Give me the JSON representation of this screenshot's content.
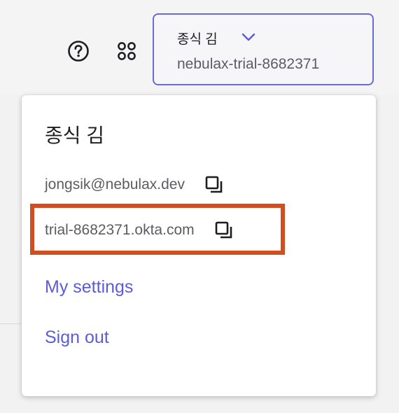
{
  "header": {
    "help_icon": "help-circle-icon",
    "apps_icon": "apps-grid-icon",
    "org_switcher": {
      "user_name": "종식 김",
      "org_id": "nebulax-trial-8682371",
      "chevron_icon": "chevron-down-icon"
    }
  },
  "dropdown": {
    "user_name": "종식 김",
    "email": "jongsik@nebulax.dev",
    "domain": "trial-8682371.okta.com",
    "copy_icon": "copy-icon",
    "links": {
      "settings": "My settings",
      "sign_out": "Sign out"
    }
  },
  "colors": {
    "accent": "#5b5cd6",
    "switcher_border": "#6a6cd6",
    "highlight": "#d04e20"
  }
}
